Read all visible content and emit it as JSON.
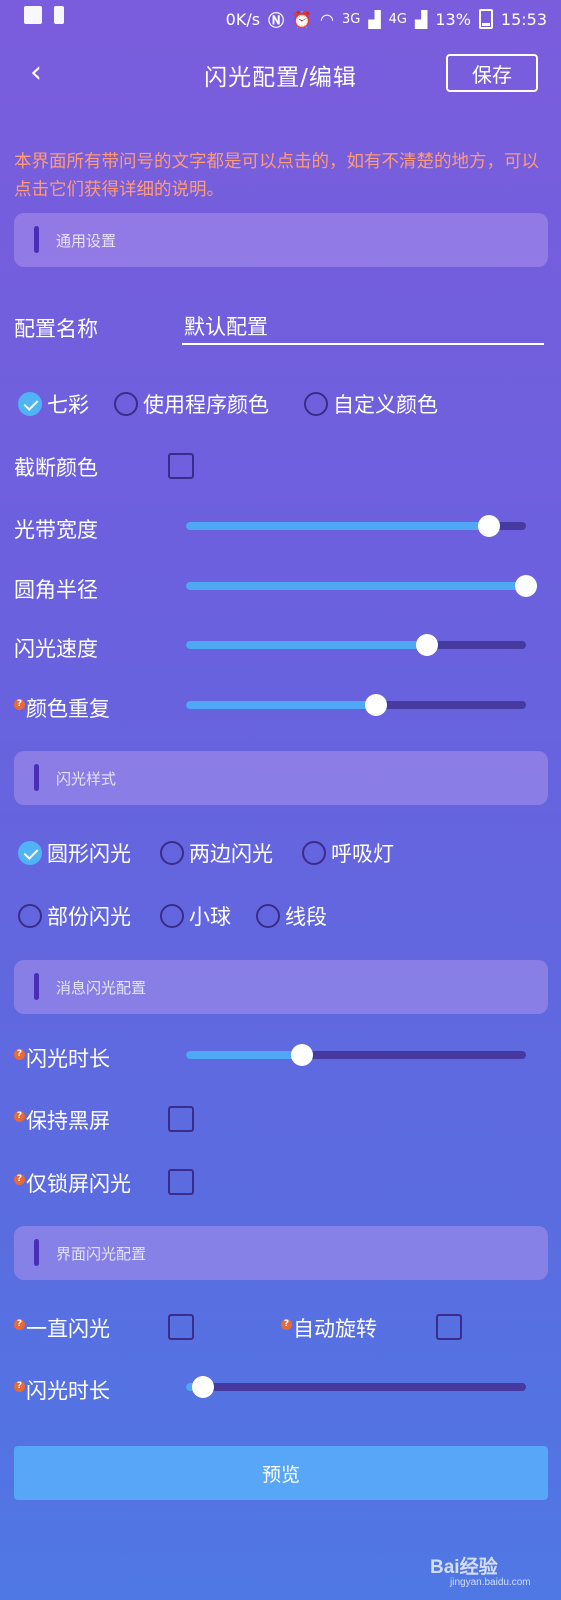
{
  "status_bar": {
    "speed": "0K/s",
    "net_3g": "3G",
    "net_4g": "4G",
    "battery": "13%",
    "time": "15:53",
    "icons": [
      "gallery-icon",
      "alert-icon",
      "nfc-icon",
      "alarm-icon",
      "wifi-icon",
      "signal-icon",
      "battery-icon"
    ]
  },
  "header": {
    "back_glyph": "‹",
    "title": "闪光配置/编辑",
    "save_label": "保存"
  },
  "notice": "本界面所有带问号的文字都是可以点击的，如有不清楚的地方，可以点击它们获得详细的说明。",
  "help_glyph": "?",
  "general": {
    "section_label": "通用设置",
    "config_name_label": "配置名称",
    "config_name_value": "默认配置",
    "color_modes": [
      {
        "label": "七彩",
        "selected": true
      },
      {
        "label": "使用程序颜色",
        "selected": false
      },
      {
        "label": "自定义颜色",
        "selected": false
      }
    ],
    "truncate_color_label": "截断颜色",
    "truncate_color_checked": false,
    "sliders": [
      {
        "label": "光带宽度",
        "value": 0.89,
        "help": false
      },
      {
        "label": "圆角半径",
        "value": 1.0,
        "help": false
      },
      {
        "label": "闪光速度",
        "value": 0.71,
        "help": false
      },
      {
        "label": "颜色重复",
        "value": 0.56,
        "help": true
      }
    ]
  },
  "style": {
    "section_label": "闪光样式",
    "options_row1": [
      {
        "label": "圆形闪光",
        "selected": true
      },
      {
        "label": "两边闪光",
        "selected": false
      },
      {
        "label": "呼吸灯",
        "selected": false
      }
    ],
    "options_row2": [
      {
        "label": "部份闪光",
        "selected": false
      },
      {
        "label": "小球",
        "selected": false
      },
      {
        "label": "线段",
        "selected": false
      }
    ]
  },
  "message": {
    "section_label": "消息闪光配置",
    "duration_label": "闪光时长",
    "duration_value": 0.34,
    "keep_black_label": "保持黑屏",
    "keep_black_checked": false,
    "lock_only_label": "仅锁屏闪光",
    "lock_only_checked": false
  },
  "ui": {
    "section_label": "界面闪光配置",
    "always_label": "一直闪光",
    "always_checked": false,
    "auto_rotate_label": "自动旋转",
    "auto_rotate_checked": false,
    "duration_label": "闪光时长",
    "duration_value": 0.05
  },
  "preview_label": "预览",
  "watermark": {
    "brand": "Bai经验",
    "url": "jingyan.baidu.com"
  },
  "colors": {
    "accent": "#4fb3f5",
    "slider_track": "#463aa0",
    "notice": "#ff9a7a",
    "button": "#58a6f7"
  }
}
